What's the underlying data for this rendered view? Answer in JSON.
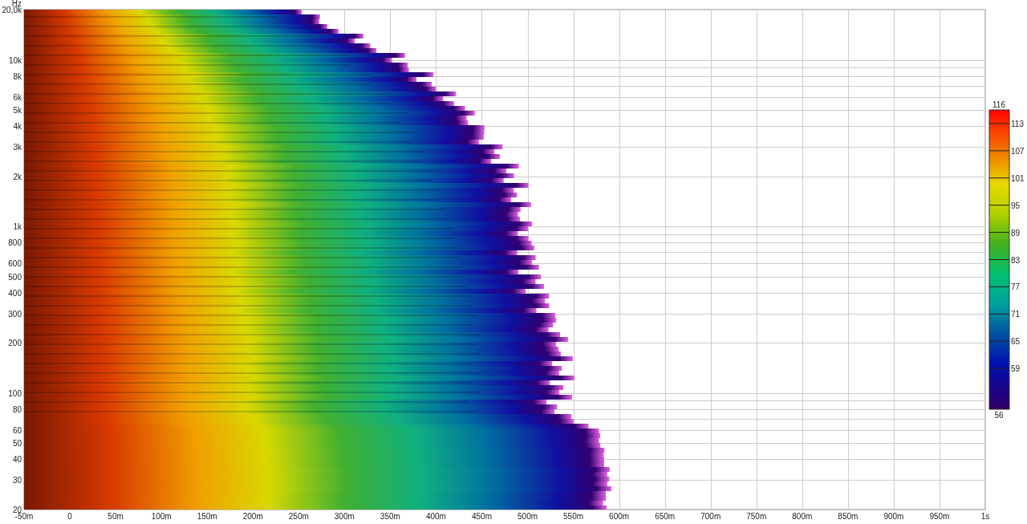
{
  "plot": {
    "y_unit": "Hz",
    "y_ticks": [
      "20,0k",
      "10k",
      "8k",
      "6k",
      "5k",
      "4k",
      "3k",
      "2k",
      "1k",
      "800",
      "600",
      "500",
      "400",
      "300",
      "200",
      "100",
      "80",
      "60",
      "50",
      "40",
      "30",
      "20"
    ],
    "x_ticks": [
      "-50m",
      "0",
      "50m",
      "100m",
      "150m",
      "200m",
      "250m",
      "300m",
      "350m",
      "400m",
      "450m",
      "500m",
      "550m",
      "600m",
      "650m",
      "700m",
      "750m",
      "800m",
      "850m",
      "900m",
      "950m",
      "1s"
    ]
  },
  "color_scale": {
    "max": "116",
    "min": "56",
    "ticks": [
      "113",
      "107",
      "101",
      "95",
      "89",
      "83",
      "77",
      "71",
      "65",
      "59"
    ]
  }
}
